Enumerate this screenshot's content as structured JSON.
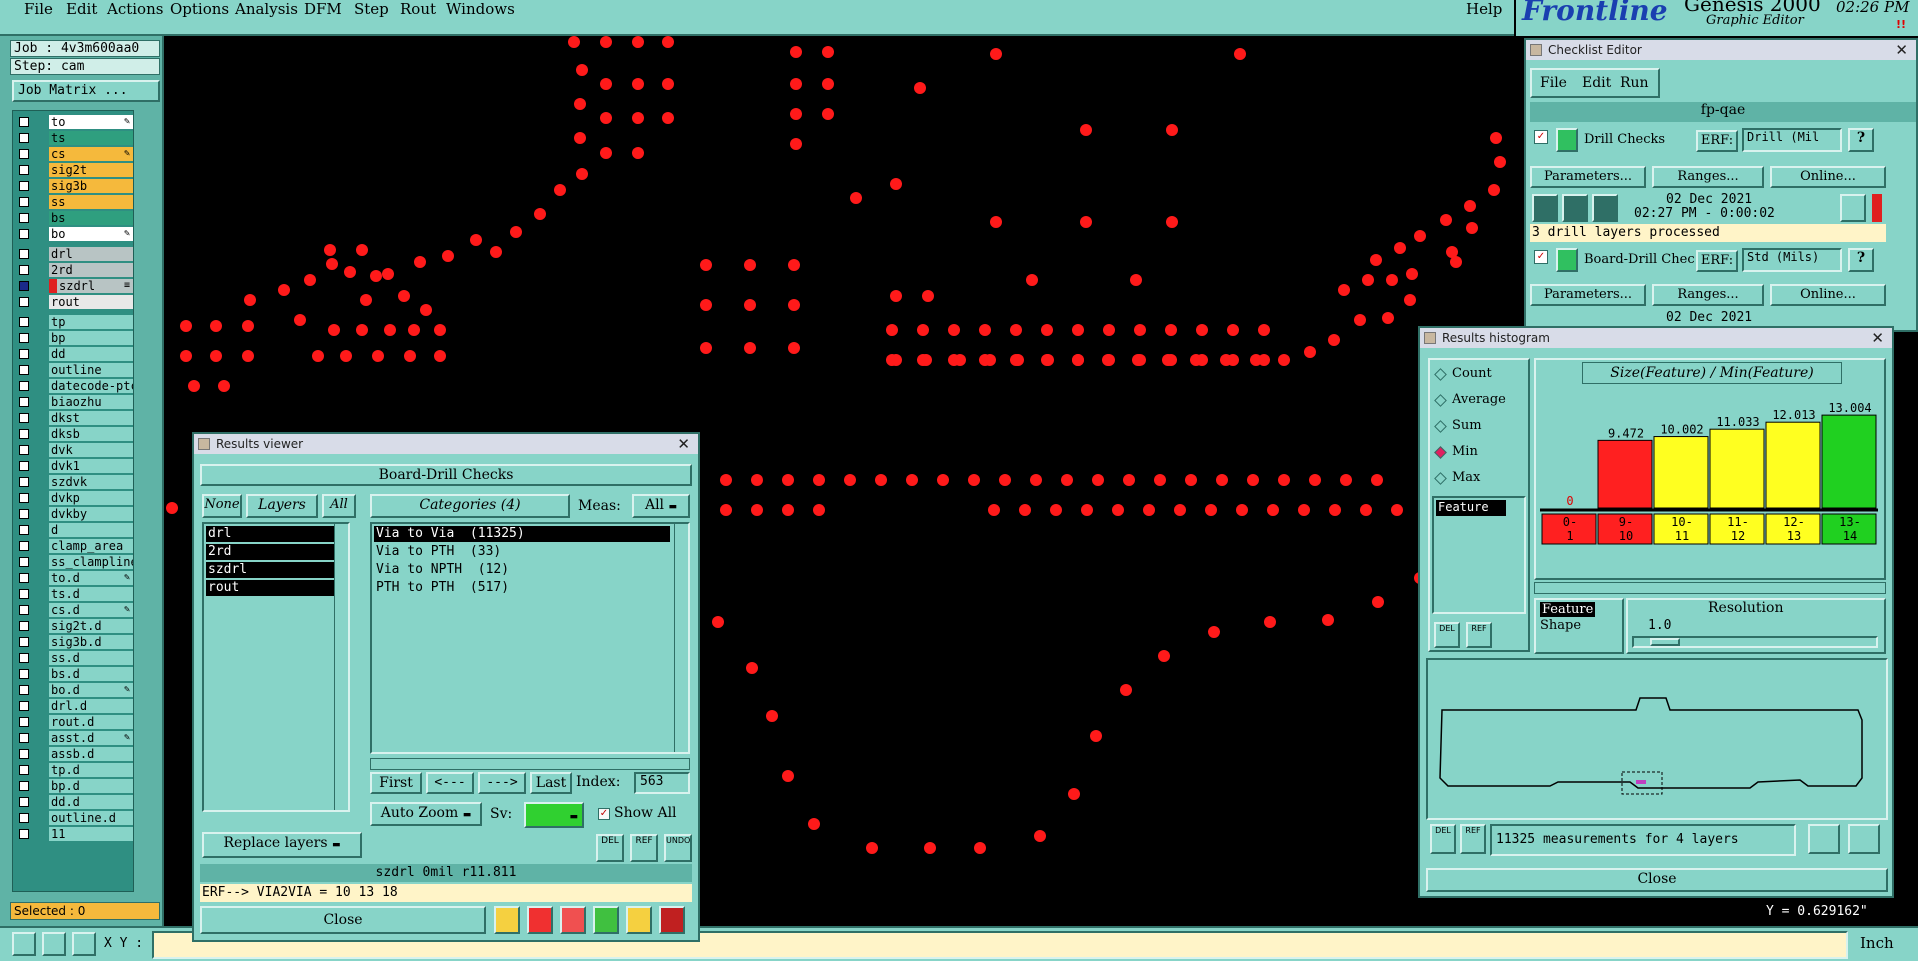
{
  "menu": {
    "items": [
      "File",
      "Edit",
      "Actions",
      "Options",
      "Analysis",
      "DFM",
      "Step",
      "Rout",
      "Windows"
    ],
    "help": "Help"
  },
  "brand": {
    "logo": "Frontline",
    "product": "Genesis 2000",
    "subtitle": "Graphic Editor",
    "time": "02:26 PM"
  },
  "left": {
    "job": "Job : 4v3m600aa0",
    "step": "Step: cam",
    "job_matrix": "Job Matrix ...",
    "selected": "Selected : 0",
    "layers": [
      {
        "name": "to",
        "color": "#ffffff",
        "mark": "pen"
      },
      {
        "name": "ts",
        "color": "#2f9f7f",
        "mark": ""
      },
      {
        "name": "cs",
        "color": "#f5b93c",
        "mark": "pen"
      },
      {
        "name": "sig2t",
        "color": "#f5b93c",
        "mark": ""
      },
      {
        "name": "sig3b",
        "color": "#f5b93c",
        "mark": ""
      },
      {
        "name": "ss",
        "color": "#f5b93c",
        "mark": ""
      },
      {
        "name": "bs",
        "color": "#2f9f7f",
        "mark": ""
      },
      {
        "name": "bo",
        "color": "#ffffff",
        "mark": "pen"
      },
      {
        "name": "drl",
        "color": "#b8c4c4",
        "mark": ""
      },
      {
        "name": "2rd",
        "color": "#b8c4c4",
        "mark": ""
      },
      {
        "name": "szdrl",
        "color": "#b8c4c4",
        "mark": "ruler"
      },
      {
        "name": "rout",
        "color": "#e8e8e8",
        "mark": ""
      },
      {
        "name": "tp",
        "color": "#87d4c8",
        "mark": ""
      },
      {
        "name": "bp",
        "color": "#87d4c8",
        "mark": ""
      },
      {
        "name": "dd",
        "color": "#87d4c8",
        "mark": ""
      },
      {
        "name": "outline",
        "color": "#87d4c8",
        "mark": ""
      },
      {
        "name": "datecode-ptc",
        "color": "#87d4c8",
        "mark": ""
      },
      {
        "name": "biaozhu",
        "color": "#87d4c8",
        "mark": ""
      },
      {
        "name": "dkst",
        "color": "#87d4c8",
        "mark": ""
      },
      {
        "name": "dksb",
        "color": "#87d4c8",
        "mark": ""
      },
      {
        "name": "dvk",
        "color": "#87d4c8",
        "mark": ""
      },
      {
        "name": "dvk1",
        "color": "#87d4c8",
        "mark": ""
      },
      {
        "name": "szdvk",
        "color": "#87d4c8",
        "mark": ""
      },
      {
        "name": "dvkp",
        "color": "#87d4c8",
        "mark": ""
      },
      {
        "name": "dvkby",
        "color": "#87d4c8",
        "mark": ""
      },
      {
        "name": "d",
        "color": "#87d4c8",
        "mark": ""
      },
      {
        "name": "clamp_area",
        "color": "#87d4c8",
        "mark": ""
      },
      {
        "name": "ss_clampline",
        "color": "#87d4c8",
        "mark": ""
      },
      {
        "name": "to.d",
        "color": "#87d4c8",
        "mark": "pen"
      },
      {
        "name": "ts.d",
        "color": "#87d4c8",
        "mark": ""
      },
      {
        "name": "cs.d",
        "color": "#87d4c8",
        "mark": "pen"
      },
      {
        "name": "sig2t.d",
        "color": "#87d4c8",
        "mark": ""
      },
      {
        "name": "sig3b.d",
        "color": "#87d4c8",
        "mark": ""
      },
      {
        "name": "ss.d",
        "color": "#87d4c8",
        "mark": ""
      },
      {
        "name": "bs.d",
        "color": "#87d4c8",
        "mark": ""
      },
      {
        "name": "bo.d",
        "color": "#87d4c8",
        "mark": "pen"
      },
      {
        "name": "drl.d",
        "color": "#87d4c8",
        "mark": ""
      },
      {
        "name": "rout.d",
        "color": "#87d4c8",
        "mark": ""
      },
      {
        "name": "asst.d",
        "color": "#87d4c8",
        "mark": "pen"
      },
      {
        "name": "assb.d",
        "color": "#87d4c8",
        "mark": ""
      },
      {
        "name": "tp.d",
        "color": "#87d4c8",
        "mark": ""
      },
      {
        "name": "bp.d",
        "color": "#87d4c8",
        "mark": ""
      },
      {
        "name": "dd.d",
        "color": "#87d4c8",
        "mark": ""
      },
      {
        "name": "outline.d",
        "color": "#87d4c8",
        "mark": ""
      },
      {
        "name": "11",
        "color": "#87d4c8",
        "mark": ""
      }
    ]
  },
  "bottom": {
    "xy_label": "X Y :",
    "xy_value": "",
    "units": "Inch",
    "y_readout": "Y = 0.629162\""
  },
  "results_viewer": {
    "title": "Results viewer",
    "header": "Board-Drill Checks",
    "none": "None",
    "layers_label": "Layers",
    "all": "All",
    "categories_label": "Categories (4)",
    "meas_label": "Meas:",
    "meas_value": "All",
    "layer_items": [
      "drl",
      "2rd",
      "szdrl",
      "rout"
    ],
    "categories": [
      "Via to Via  (11325)",
      "Via to PTH  (33)",
      "Via to NPTH  (12)",
      "PTH to PTH  (517)"
    ],
    "first": "First",
    "prev": "<---",
    "next": "--->",
    "last": "Last",
    "index_label": "Index:",
    "index_value": "563",
    "auto_zoom": "Auto Zoom",
    "sv_label": "Sv:",
    "show_all": "Show All",
    "replace_layers": "Replace layers",
    "del": "DEL",
    "ref": "REF",
    "undo": "UNDO",
    "info": "szdrl  0mil  r11.811",
    "erf": "ERF--> VIA2VIA = 10 13 18",
    "close": "Close"
  },
  "checklist": {
    "title": "Checklist Editor",
    "menu": [
      "File",
      "Edit",
      "Run"
    ],
    "name": "fp-qae",
    "checks": [
      {
        "name": "Drill Checks",
        "erf_label": "ERF:",
        "erf_value": "Drill (Mil",
        "date": "02 Dec 2021",
        "time": "02:27 PM - 0:00:02",
        "status": "3 drill layers processed"
      },
      {
        "name": "Board-Drill Checks",
        "erf_label": "ERF:",
        "erf_value": "Std (Mils)",
        "date": "02 Dec 2021",
        "time": "",
        "status": ""
      }
    ],
    "parameters": "Parameters...",
    "ranges": "Ranges...",
    "online": "Online..."
  },
  "histogram": {
    "title": "Results histogram",
    "options": [
      "Count",
      "Average",
      "Sum",
      "Min",
      "Max"
    ],
    "selected_option": "Min",
    "list_items": [
      "Feature"
    ],
    "chart_title": "Size(Feature) / Min(Feature)",
    "feature_box": [
      "Feature",
      "Shape"
    ],
    "resolution_label": "Resolution",
    "resolution_value": "1.0",
    "measurements": "11325 measurements for 4 layers",
    "close": "Close",
    "del": "DEL",
    "ref": "REF"
  },
  "chart_data": {
    "type": "bar",
    "title": "Size(Feature) / Min(Feature)",
    "categories": [
      "0-1",
      "9-10",
      "10-11",
      "11-12",
      "12-13",
      "13-14"
    ],
    "values": [
      0,
      9.472,
      10.002,
      11.033,
      12.013,
      13.004
    ],
    "value_labels": [
      "0",
      "9.472",
      "10.002",
      "11.033",
      "12.013",
      "13.004"
    ],
    "colors": [
      "#ff2020",
      "#ff2020",
      "#ffff20",
      "#ffff20",
      "#ffff20",
      "#20d020"
    ],
    "ylim": [
      0,
      14
    ]
  }
}
